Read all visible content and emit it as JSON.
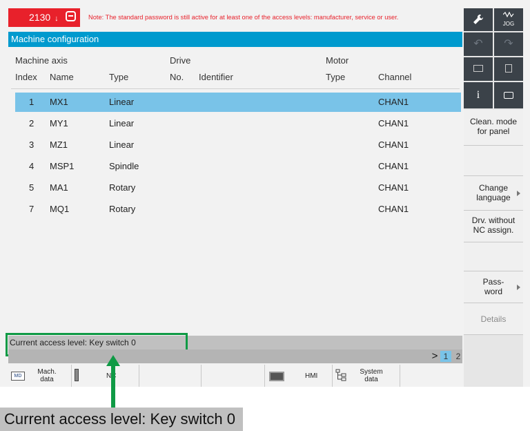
{
  "alarm": {
    "number": "2130",
    "arrow": "↓",
    "ack_icon": "minus-circle-icon",
    "message": "Note: The standard password is still active for at least one of the access levels: manufacturer, service or user."
  },
  "title": "Machine configuration",
  "table": {
    "group_headers": {
      "machine_axis": "Machine axis",
      "drive": "Drive",
      "motor": "Motor"
    },
    "columns": {
      "index": "Index",
      "name": "Name",
      "type": "Type",
      "drive_no": "No.",
      "identifier": "Identifier",
      "motor_type": "Type",
      "channel": "Channel"
    },
    "rows": [
      {
        "index": "1",
        "name": "MX1",
        "type": "Linear",
        "channel": "CHAN1",
        "selected": true
      },
      {
        "index": "2",
        "name": "MY1",
        "type": "Linear",
        "channel": "CHAN1"
      },
      {
        "index": "3",
        "name": "MZ1",
        "type": "Linear",
        "channel": "CHAN1"
      },
      {
        "index": "4",
        "name": "MSP1",
        "type": "Spindle",
        "channel": "CHAN1"
      },
      {
        "index": "5",
        "name": "MA1",
        "type": "Rotary",
        "channel": "CHAN1"
      },
      {
        "index": "7",
        "name": "MQ1",
        "type": "Rotary",
        "channel": "CHAN1"
      }
    ]
  },
  "status": {
    "access_level": "Current access level: Key switch 0"
  },
  "pager": {
    "next": ">",
    "page1": "1",
    "page2": "2",
    "active_page": "1"
  },
  "bottom_keys": {
    "mach_data": {
      "icon_label": "MD",
      "line1": "Mach.",
      "line2": "data"
    },
    "nc": {
      "label": "NC"
    },
    "hmi": {
      "label": "HMI"
    },
    "system_data": {
      "line1": "System",
      "line2": "data"
    }
  },
  "sidebar": {
    "top_buttons": {
      "settings_icon": "wrench-icon",
      "jog": "JOG",
      "undo_icon": "undo-icon",
      "redo_icon": "redo-icon",
      "keyboard_icon": "keyboard-icon",
      "calculator_icon": "calculator-icon",
      "info": "i",
      "screenshot_icon": "screenshot-icon"
    },
    "keys": {
      "clean_mode": {
        "line1": "Clean. mode",
        "line2": "for panel"
      },
      "change_language": {
        "line1": "Change",
        "line2": "language"
      },
      "drv_without": {
        "line1": "Drv. without",
        "line2": "NC assign."
      },
      "password": {
        "line1": "Pass-",
        "line2": "word"
      },
      "details": "Details"
    }
  },
  "caption": "Current access level: Key switch 0",
  "colors": {
    "alarm_red": "#e8212b",
    "title_blue": "#009ace",
    "selected_row": "#79c3e8",
    "highlight_green": "#0f9a45",
    "sidebar_dark": "#3b4249"
  }
}
